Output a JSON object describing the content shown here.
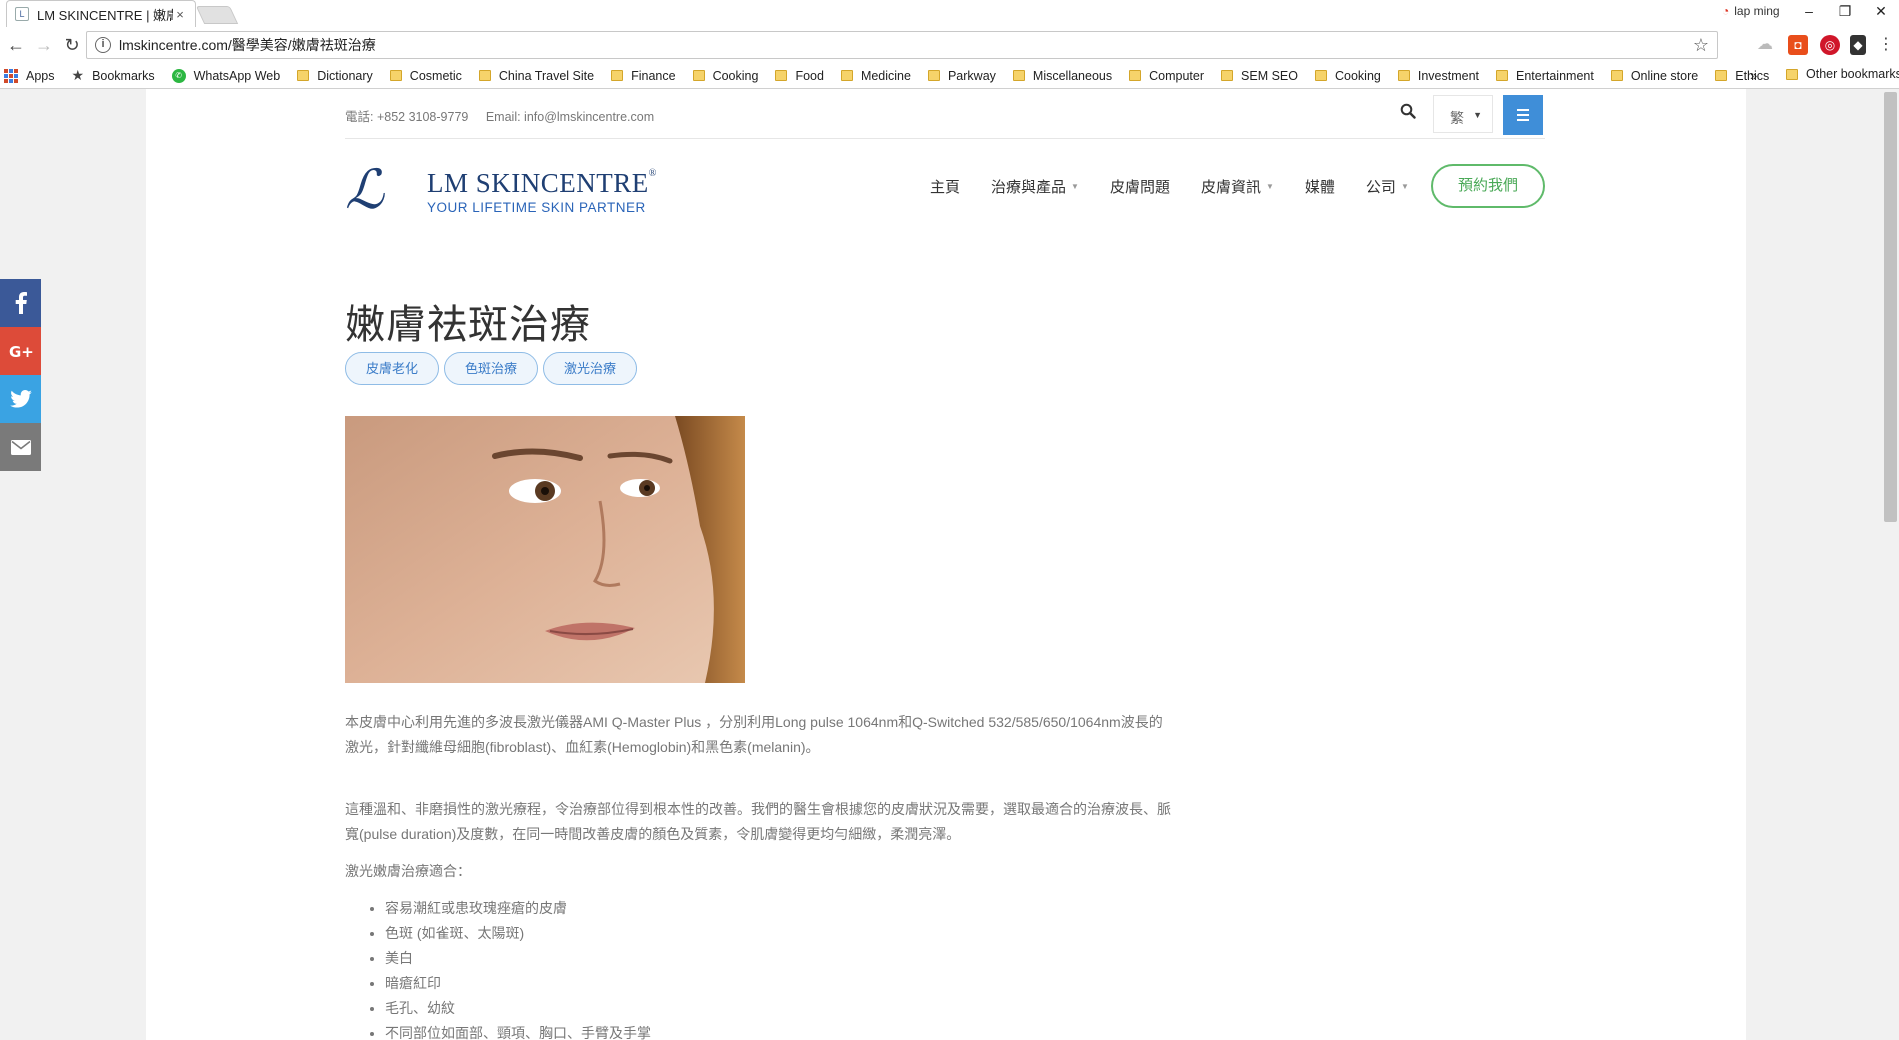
{
  "browser": {
    "tab_title": "LM SKINCENTRE | 嫩膚祛",
    "tab_close": "×",
    "user_name": "lap ming",
    "url": "lmskincentre.com/醫學美容/嫩膚祛斑治療",
    "window_buttons": [
      "–",
      "❐",
      "✕"
    ]
  },
  "bookmarks": {
    "apps": "Apps",
    "bookmarks": "Bookmarks",
    "whatsapp": "WhatsApp Web",
    "folders": [
      "Dictionary",
      "Cosmetic",
      "China Travel Site",
      "Finance",
      "Cooking",
      "Food",
      "Medicine",
      "Parkway",
      "Miscellaneous",
      "Computer",
      "SEM SEO",
      "Cooking",
      "Investment",
      "Entertainment",
      "Online store",
      "Ethics"
    ],
    "more": "»",
    "other": "Other bookmarks"
  },
  "site": {
    "phone": "電話: +852 3108-9779",
    "email": "Email: info@lmskincentre.com",
    "lang_selected": "繁",
    "logo_name": "LM SKINCENTRE",
    "logo_tagline": "YOUR LIFETIME SKIN PARTNER",
    "nav": [
      {
        "label": "主頁",
        "dropdown": false
      },
      {
        "label": "治療與產品",
        "dropdown": true
      },
      {
        "label": "皮膚問題",
        "dropdown": false
      },
      {
        "label": "皮膚資訊",
        "dropdown": true
      },
      {
        "label": "媒體",
        "dropdown": false
      },
      {
        "label": "公司",
        "dropdown": true
      }
    ],
    "book_button": "預約我們"
  },
  "article": {
    "title": "嫩膚祛斑治療",
    "tags": [
      "皮膚老化",
      "色斑治療",
      "激光治療"
    ],
    "p1_line1": "本皮膚中心利用先進的多波長激光儀器AMI Q-Master Plus ，分別利用Long pulse 1064nm和Q-Switched 532/585/650/1064nm波長的",
    "p1_line2": "激光，針對纖維母細胞(fibroblast)、血紅素(Hemoglobin)和黑色素(melanin)。",
    "p2_line1": "這種溫和、非磨損性的激光療程，令治療部位得到根本性的改善。我們的醫生會根據您的皮膚狀況及需要，選取最適合的治療波長、脈",
    "p2_line2": "寬(pulse duration)及度數，在同一時間改善皮膚的顏色及質素，令肌膚變得更均勻細緻，柔潤亮澤。",
    "suitable_heading": "激光嫩膚治療適合：",
    "suitable_list": [
      "容易潮紅或患玫瑰痤瘡的皮膚",
      "色斑 (如雀斑、太陽斑)",
      "美白",
      "暗瘡紅印",
      "毛孔、幼紋",
      "不同部位如面部、頸項、胸口、手臂及手掌"
    ]
  },
  "social": [
    "facebook-icon",
    "google-plus-icon",
    "twitter-icon",
    "email-icon"
  ],
  "colors": {
    "accent_blue": "#3f8ed8",
    "brand_navy": "#1f3f73",
    "book_green": "#5fba6a",
    "facebook": "#3b5998",
    "google_plus": "#dd4b39",
    "twitter": "#3aa3e3",
    "email": "#7a7a7a"
  }
}
